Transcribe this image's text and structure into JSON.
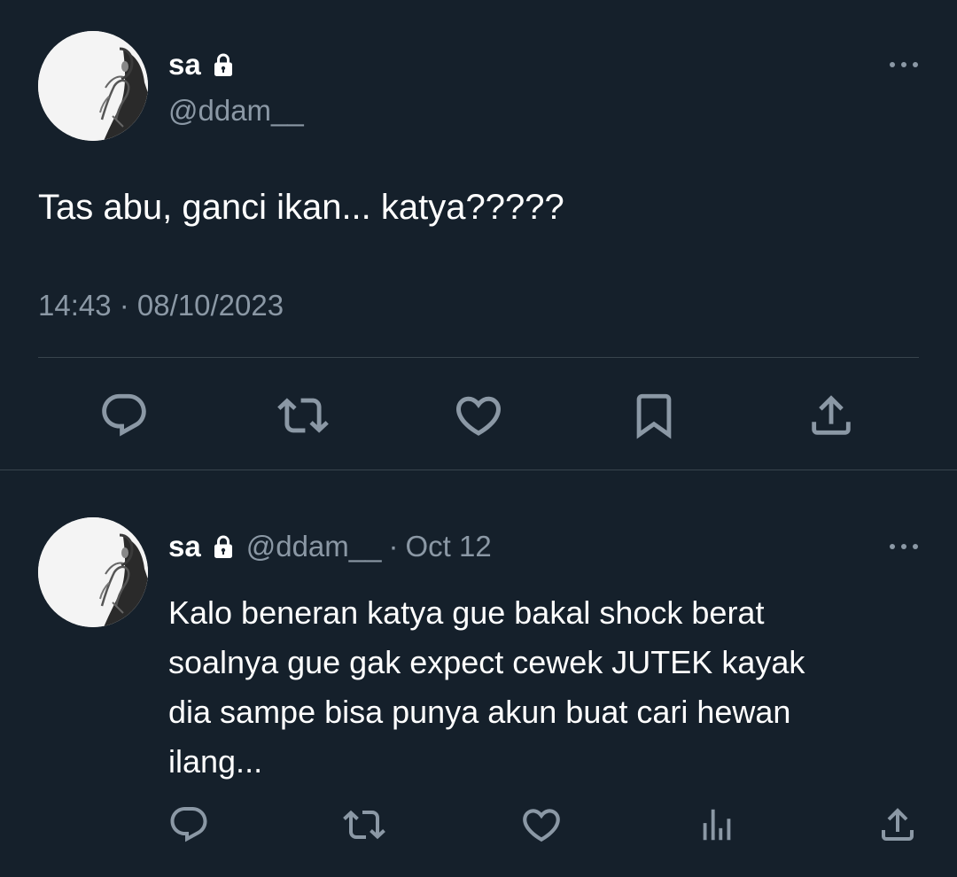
{
  "main_tweet": {
    "display_name": "sa",
    "handle": "@ddam__",
    "text": "Tas abu, ganci ikan... katya?????",
    "timestamp": "14:43 · 08/10/2023",
    "icons": [
      "lock-icon",
      "more-icon",
      "reply-icon",
      "retweet-icon",
      "like-icon",
      "bookmark-icon",
      "share-icon"
    ]
  },
  "reply": {
    "display_name": "sa",
    "handle": "@ddam__",
    "separator": "·",
    "time": "Oct 12",
    "text_lines": [
      "Kalo beneran katya gue bakal shock berat",
      "soalnya gue gak expect cewek JUTEK kayak",
      "dia sampe bisa punya akun buat cari hewan",
      "ilang..."
    ],
    "icons": [
      "lock-icon",
      "more-icon",
      "reply-icon",
      "retweet-icon",
      "like-icon",
      "views-icon",
      "share-icon"
    ]
  },
  "colors": {
    "background": "#15202b",
    "text_primary": "#ffffff",
    "text_secondary": "#8b98a5",
    "divider": "#38444d"
  }
}
